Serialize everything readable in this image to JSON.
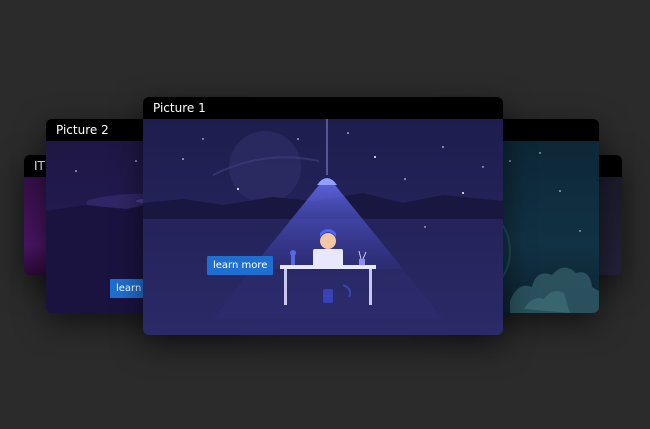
{
  "carousel": {
    "cards": {
      "far_left": {
        "title": "ITI"
      },
      "left": {
        "title": "Picture 2",
        "button": "learn m"
      },
      "center": {
        "title": "Picture 1",
        "button": "learn more"
      },
      "right": {
        "title": ""
      },
      "far_right": {
        "title": ""
      }
    }
  },
  "colors": {
    "page_background": "#2b2b2b",
    "title_bar": "#000000",
    "button": "#1f6fd1",
    "scene_center": "#24245a"
  }
}
